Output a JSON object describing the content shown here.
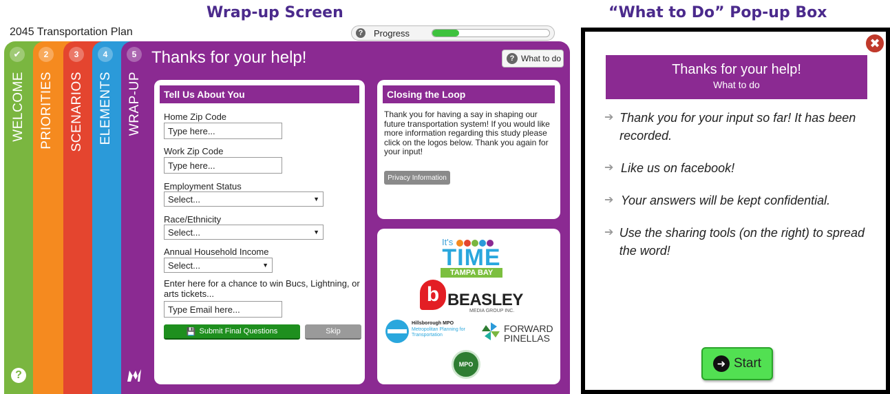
{
  "captions": {
    "left": "Wrap-up Screen",
    "right": "“What to Do” Pop-up Box"
  },
  "app": {
    "title": "2045 Transportation Plan"
  },
  "progress": {
    "label": "Progress",
    "fraction": 0.23
  },
  "tabs": [
    {
      "number": "",
      "label": "WELCOME",
      "icon": "check-icon",
      "color": "#7ab640"
    },
    {
      "number": "2",
      "label": "PRIORITIES",
      "color": "#f58a1f"
    },
    {
      "number": "3",
      "label": "SCENARIOS",
      "color": "#e4452f"
    },
    {
      "number": "4",
      "label": "ELEMENTS",
      "color": "#2b9ad9"
    },
    {
      "number": "5",
      "label": "WRAP-UP",
      "color": "#8b2a92"
    }
  ],
  "page": {
    "title": "Thanks for your help!",
    "what_to_do": "What to do"
  },
  "form": {
    "heading": "Tell Us About You",
    "home_zip_label": "Home Zip Code",
    "home_zip_placeholder": "Type here...",
    "work_zip_label": "Work Zip Code",
    "work_zip_placeholder": "Type here...",
    "employment_label": "Employment Status",
    "employment_value": "Select...",
    "race_label": "Race/Ethnicity",
    "race_value": "Select...",
    "income_label": "Annual Household Income",
    "income_value": "Select...",
    "win_text": "Enter here for a chance to win Bucs, Lightning, or arts tickets...",
    "email_placeholder": "Type Email here...",
    "submit_label": "Submit Final Questions",
    "skip_label": "Skip"
  },
  "closing": {
    "heading": "Closing the Loop",
    "text": "Thank you for having a say in shaping our future transportation system! If you would like more information regarding this study please click on the logos below. Thank you again for your input!",
    "privacy_label": "Privacy Information"
  },
  "logos": {
    "time_prefix": "It's",
    "time_word": "TIME",
    "time_region": "TAMPA BAY",
    "beasley_letter": "b",
    "beasley_word": "BEASLEY",
    "beasley_sub": "MEDIA GROUP INC.",
    "mpo_title": "Hillsborough MPO",
    "mpo_sub": "Metropolitan Planning for Transportation",
    "fp_line1": "FORWARD",
    "fp_line2": "PINELLAS",
    "pasco": "MPO"
  },
  "popup": {
    "title": "Thanks for your help!",
    "subtitle": "What to do",
    "items": [
      "Thank you for your input so far! It has been recorded.",
      "Like us on facebook!",
      "Your answers will be kept confidential.",
      "Use the sharing tools (on the right) to spread the word!"
    ],
    "start_label": "Start"
  },
  "colors": {
    "purple": "#8b2a92",
    "green": "#7ab640",
    "orange": "#f58a1f",
    "red": "#e4452f",
    "blue": "#2b9ad9",
    "submit_green": "#1e8f1e",
    "start_green": "#52e052"
  }
}
